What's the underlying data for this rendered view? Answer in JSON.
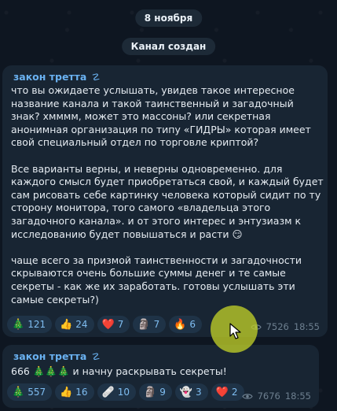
{
  "date_label": "8 ноября",
  "service_event": "Канал создан",
  "colors": {
    "background": "#0e1621",
    "bubble": "#182533",
    "accent": "#6ab2f2",
    "reaction_bg": "#1f3347"
  },
  "messages": [
    {
      "sender": "закон третта",
      "badge_icon": "verified-swirl-icon",
      "badge_glyph": "☡",
      "paragraphs": [
        "что вы ожидаете услышать, увидев такое интересное название канала и такой таинственный и загадочный знак? хмммм, может это массоны? или секретная анонимная организация по типу «ГИДРЫ» которая имеет свой специальный отдел по торговле криптой?",
        "Все варианты верны, и неверны одновременно. для каждого смысл будет приобретаться свой, и каждый будет сам рисовать себе картинку человека который сидит по ту сторону монитора, того самого «владельца этого загадочного канала». и от этого интерес и энтузиазм к исследованию будет повышаться и расти 😏",
        "чаще всего за призмой таинственности и загадочности скрываются очень большие суммы денег и те самые секреты - как же их заработать. готовы услышать эти самые секреты?)"
      ],
      "reactions": [
        {
          "icon": "christmas-tree-icon",
          "emoji": "🎄",
          "count": "121"
        },
        {
          "icon": "thumbs-up-icon",
          "emoji": "👍",
          "count": "24"
        },
        {
          "icon": "heart-icon",
          "emoji": "❤️",
          "count": "7"
        },
        {
          "icon": "moai-icon",
          "emoji": "🗿",
          "count": "7"
        },
        {
          "icon": "fire-icon",
          "emoji": "🔥",
          "count": "6"
        }
      ],
      "views": "7526",
      "time": "18:55"
    },
    {
      "sender": "закон третта",
      "badge_icon": "verified-swirl-icon",
      "badge_glyph": "☡",
      "paragraphs": [
        "666 🎄🎄🎄 и начну раскрывать секреты!"
      ],
      "reactions": [
        {
          "icon": "christmas-tree-icon",
          "emoji": "🎄",
          "count": "557"
        },
        {
          "icon": "thumbs-up-icon",
          "emoji": "👍",
          "count": "16"
        },
        {
          "icon": "bandage-icon",
          "emoji": "🩹",
          "count": "10"
        },
        {
          "icon": "moai-icon",
          "emoji": "🗿",
          "count": "9"
        },
        {
          "icon": "ghost-icon",
          "emoji": "👻",
          "count": "3"
        },
        {
          "icon": "heart-icon",
          "emoji": "❤️",
          "count": "2"
        }
      ],
      "views": "7676",
      "time": "18:55"
    }
  ]
}
